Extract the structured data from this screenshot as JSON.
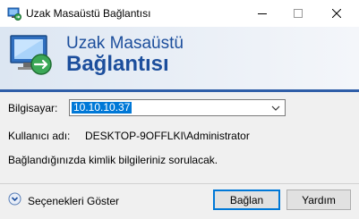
{
  "window": {
    "title": "Uzak Masaüstü Bağlantısı"
  },
  "banner": {
    "line1": "Uzak Masaüstü",
    "line2": "Bağlantısı"
  },
  "form": {
    "computer_label": "Bilgisayar:",
    "computer_value": "10.10.10.37",
    "user_label": "Kullanıcı adı:",
    "user_value": "DESKTOP-9OFFLKI\\Administrator",
    "info_text": "Bağlandığınızda kimlik bilgileriniz sorulacak."
  },
  "footer": {
    "options_label": "Seçenekleri Göster",
    "connect_label": "Bağlan",
    "help_label": "Yardım"
  },
  "icons": {
    "app": "remote-desktop-icon",
    "banner": "remote-desktop-large-icon",
    "options": "expand-options-icon"
  },
  "colors": {
    "accent": "#1c4e9c",
    "selection": "#0078d7"
  }
}
